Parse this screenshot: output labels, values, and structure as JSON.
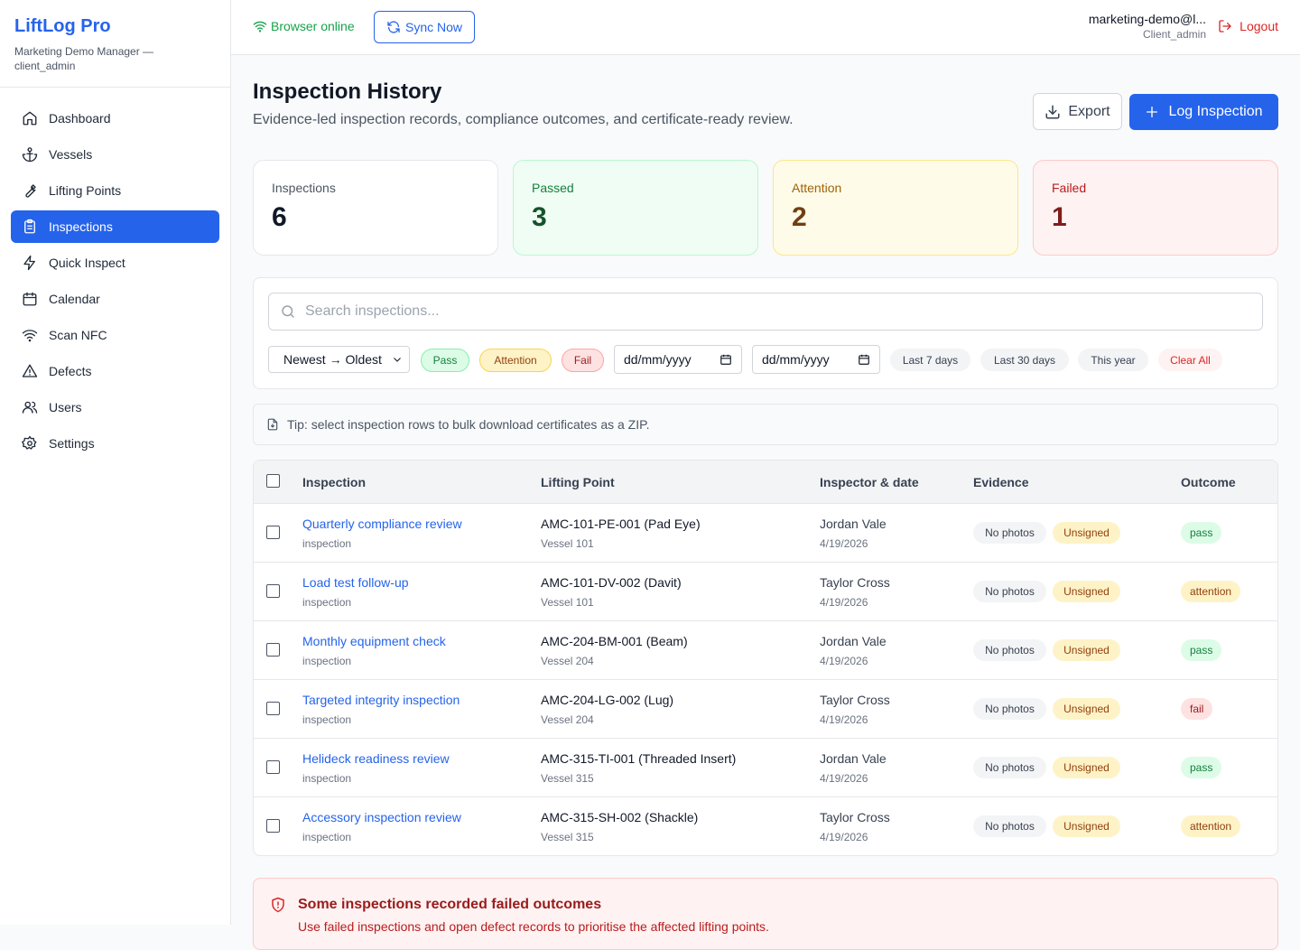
{
  "brand": {
    "title": "LiftLog Pro",
    "subtitle": "Marketing Demo Manager — client_admin"
  },
  "nav": [
    {
      "label": "Dashboard",
      "icon": "home-icon"
    },
    {
      "label": "Vessels",
      "icon": "anchor-icon"
    },
    {
      "label": "Lifting Points",
      "icon": "wrench-icon"
    },
    {
      "label": "Inspections",
      "icon": "clipboard-icon",
      "active": true
    },
    {
      "label": "Quick Inspect",
      "icon": "bolt-icon"
    },
    {
      "label": "Calendar",
      "icon": "calendar-icon"
    },
    {
      "label": "Scan NFC",
      "icon": "wifi-icon"
    },
    {
      "label": "Defects",
      "icon": "warning-icon"
    },
    {
      "label": "Users",
      "icon": "users-icon"
    },
    {
      "label": "Settings",
      "icon": "gear-icon"
    }
  ],
  "topbar": {
    "status": "Browser online",
    "sync_label": "Sync Now",
    "user_email": "marketing-demo@l...",
    "user_role": "Client_admin",
    "logout_label": "Logout"
  },
  "page": {
    "title": "Inspection History",
    "subtitle": "Evidence-led inspection records, compliance outcomes, and certificate-ready review.",
    "export_label": "Export",
    "log_label": "Log Inspection"
  },
  "stats": [
    {
      "label": "Inspections",
      "value": "6"
    },
    {
      "label": "Passed",
      "value": "3"
    },
    {
      "label": "Attention",
      "value": "2"
    },
    {
      "label": "Failed",
      "value": "1"
    }
  ],
  "filters": {
    "search_placeholder": "Search inspections...",
    "sort_value": "Newest → Oldest",
    "chip_pass": "Pass",
    "chip_attention": "Attention",
    "chip_fail": "Fail",
    "date_from": "dd/mm/yyyy",
    "date_to": "dd/mm/yyyy",
    "last7": "Last 7 days",
    "last30": "Last 30 days",
    "this_year": "This year",
    "clear_all": "Clear All"
  },
  "tip": "Tip: select inspection rows to bulk download certificates as a ZIP.",
  "table": {
    "headers": [
      "Inspection",
      "Lifting Point",
      "Inspector & date",
      "Evidence",
      "Outcome"
    ],
    "rows": [
      {
        "title": "Quarterly compliance review",
        "type": "inspection",
        "lifting_point": "AMC-101-PE-001 (Pad Eye)",
        "vessel": "Vessel 101",
        "inspector": "Jordan Vale",
        "date": "4/19/2026",
        "photos": "No photos",
        "signature": "Unsigned",
        "outcome": "pass"
      },
      {
        "title": "Load test follow-up",
        "type": "inspection",
        "lifting_point": "AMC-101-DV-002 (Davit)",
        "vessel": "Vessel 101",
        "inspector": "Taylor Cross",
        "date": "4/19/2026",
        "photos": "No photos",
        "signature": "Unsigned",
        "outcome": "attention"
      },
      {
        "title": "Monthly equipment check",
        "type": "inspection",
        "lifting_point": "AMC-204-BM-001 (Beam)",
        "vessel": "Vessel 204",
        "inspector": "Jordan Vale",
        "date": "4/19/2026",
        "photos": "No photos",
        "signature": "Unsigned",
        "outcome": "pass"
      },
      {
        "title": "Targeted integrity inspection",
        "type": "inspection",
        "lifting_point": "AMC-204-LG-002 (Lug)",
        "vessel": "Vessel 204",
        "inspector": "Taylor Cross",
        "date": "4/19/2026",
        "photos": "No photos",
        "signature": "Unsigned",
        "outcome": "fail"
      },
      {
        "title": "Helideck readiness review",
        "type": "inspection",
        "lifting_point": "AMC-315-TI-001 (Threaded Insert)",
        "vessel": "Vessel 315",
        "inspector": "Jordan Vale",
        "date": "4/19/2026",
        "photos": "No photos",
        "signature": "Unsigned",
        "outcome": "pass"
      },
      {
        "title": "Accessory inspection review",
        "type": "inspection",
        "lifting_point": "AMC-315-SH-002 (Shackle)",
        "vessel": "Vessel 315",
        "inspector": "Taylor Cross",
        "date": "4/19/2026",
        "photos": "No photos",
        "signature": "Unsigned",
        "outcome": "attention"
      }
    ]
  },
  "alert": {
    "title": "Some inspections recorded failed outcomes",
    "body": "Use failed inspections and open defect records to prioritise the affected lifting points."
  }
}
